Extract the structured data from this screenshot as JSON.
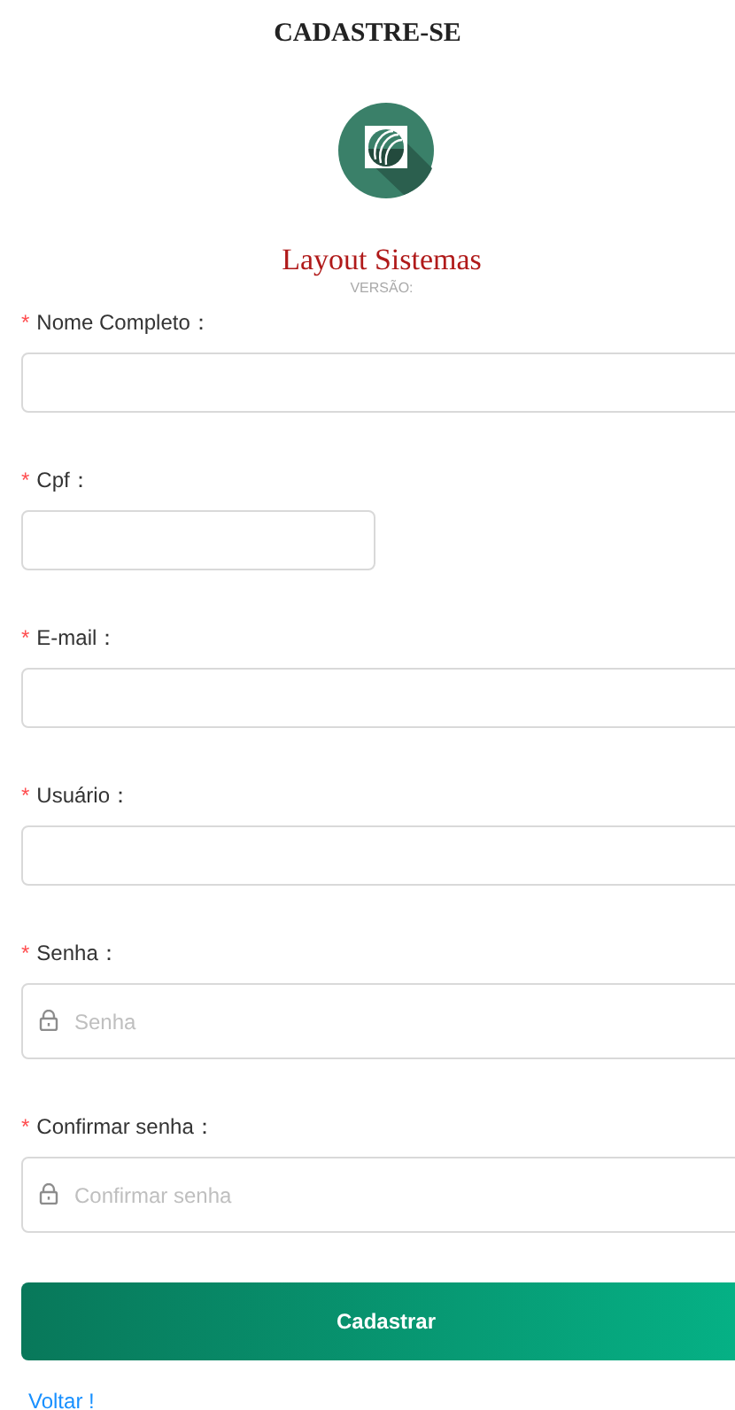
{
  "title": "CADASTRE-SE",
  "brand": {
    "name": "Layout Sistemas",
    "version": "VERSÃO:"
  },
  "required_mark": "*",
  "fields": [
    {
      "label": "Nome Completo：",
      "kind": "text",
      "required": true
    },
    {
      "label": "Cpf：",
      "kind": "short",
      "required": true
    },
    {
      "label": "E-mail：",
      "kind": "text",
      "required": true
    },
    {
      "label": "Usuário：",
      "kind": "text",
      "required": true
    },
    {
      "label": "Senha：",
      "kind": "password",
      "required": true,
      "placeholder": "Senha"
    },
    {
      "label": "Confirmar senha：",
      "kind": "password",
      "required": true,
      "placeholder": "Confirmar senha"
    }
  ],
  "submit": "Cadastrar",
  "back_link": "Voltar !"
}
